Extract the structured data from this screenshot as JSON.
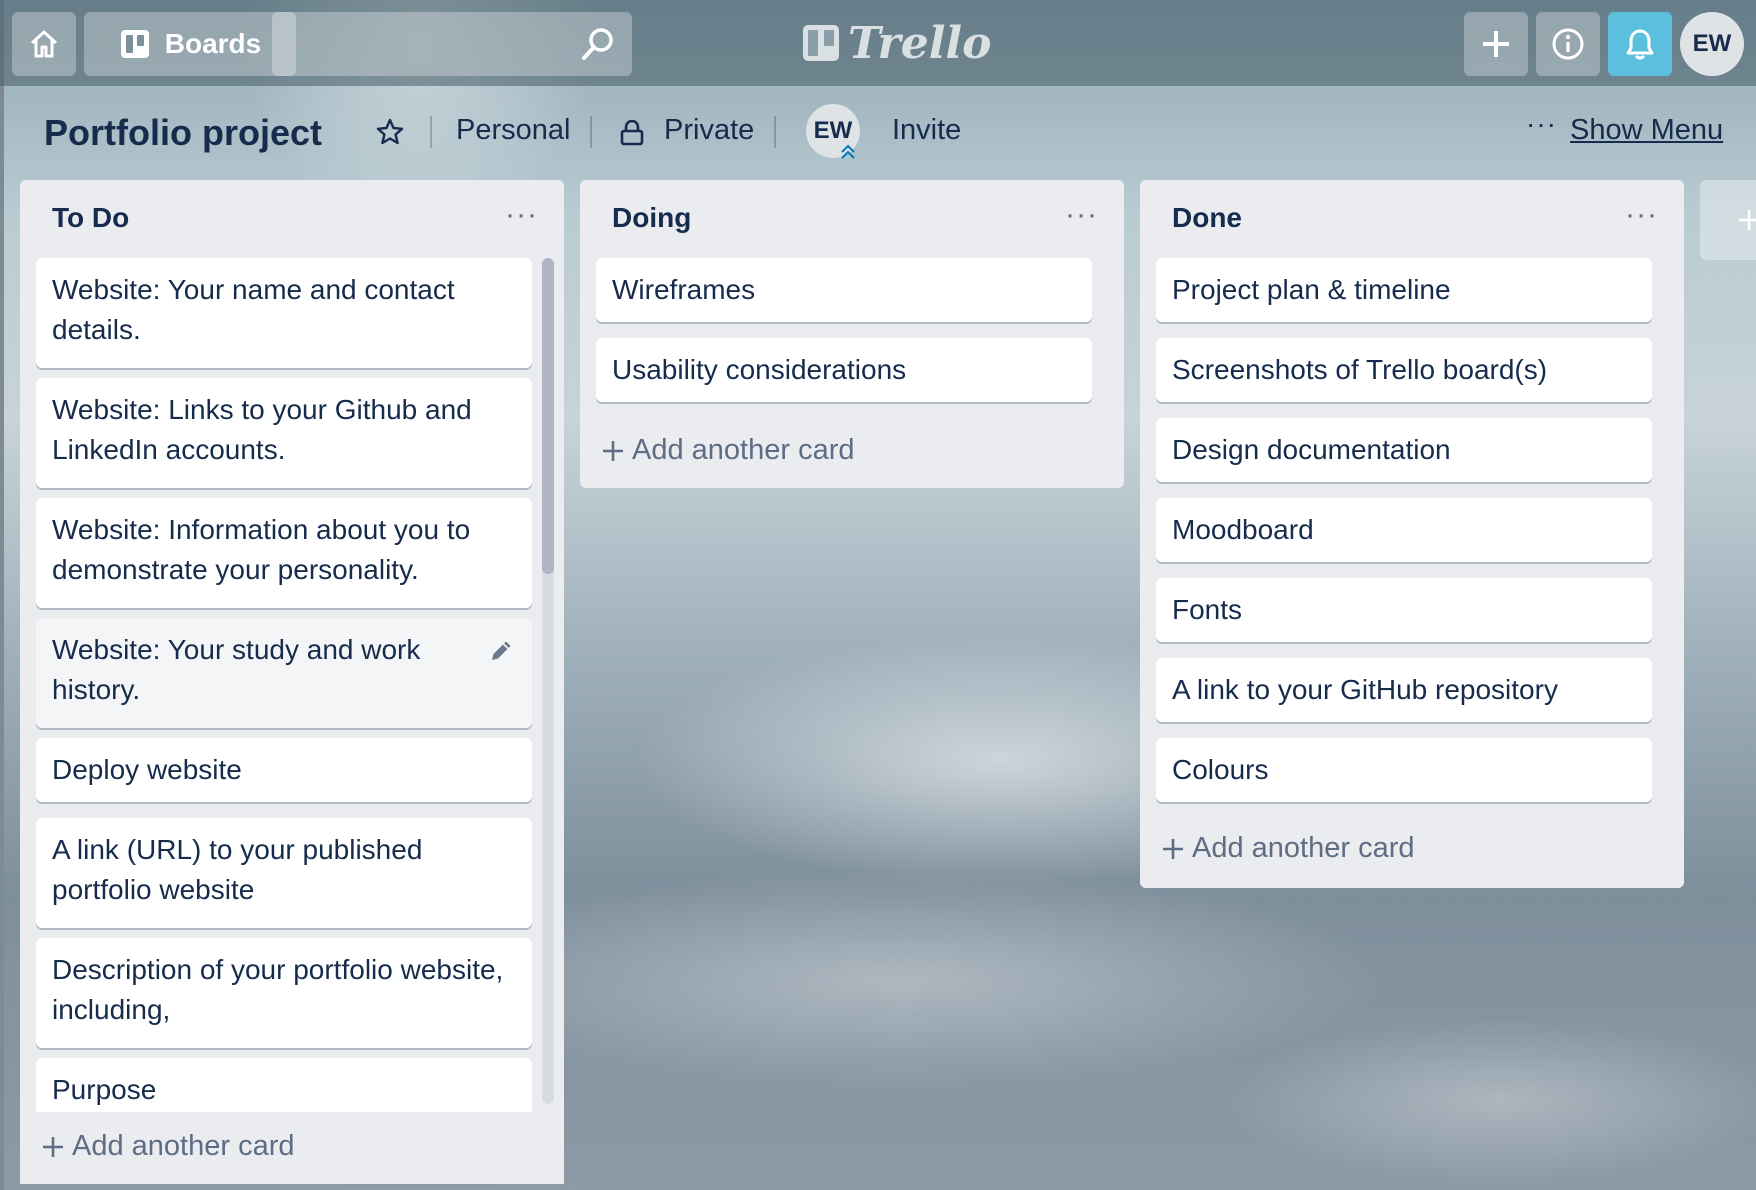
{
  "topbar": {
    "boards_label": "Boards",
    "search_value": "",
    "logo_text": "Trello",
    "user_initials": "EW",
    "notification_color": "#5bc0de"
  },
  "board": {
    "title": "Portfolio project",
    "team": "Personal",
    "visibility": "Private",
    "member_initials": "EW",
    "invite_label": "Invite",
    "menu_dots": "···",
    "show_menu_label": "Show Menu"
  },
  "lists": [
    {
      "title": "To Do",
      "menu": "···",
      "cards": [
        "Website: Your name and contact details.",
        "Website: Links to your Github and LinkedIn accounts.",
        "Website: Information about you to demonstrate your personality.",
        "Website: Your study and work history.",
        "Deploy website",
        "A link (URL) to your published portfolio website",
        "Description of your portfolio website, including,",
        "Purpose"
      ],
      "add_card": "Add another card"
    },
    {
      "title": "Doing",
      "menu": "···",
      "cards": [
        "Wireframes",
        "Usability considerations"
      ],
      "add_card": "Add another card"
    },
    {
      "title": "Done",
      "menu": "···",
      "cards": [
        "Project plan & timeline",
        "Screenshots of Trello board(s)",
        "Design documentation",
        "Moodboard",
        "Fonts",
        "A link to your GitHub repository",
        "Colours"
      ],
      "add_card": "Add another card"
    }
  ],
  "add_list_icon": "plus-icon"
}
